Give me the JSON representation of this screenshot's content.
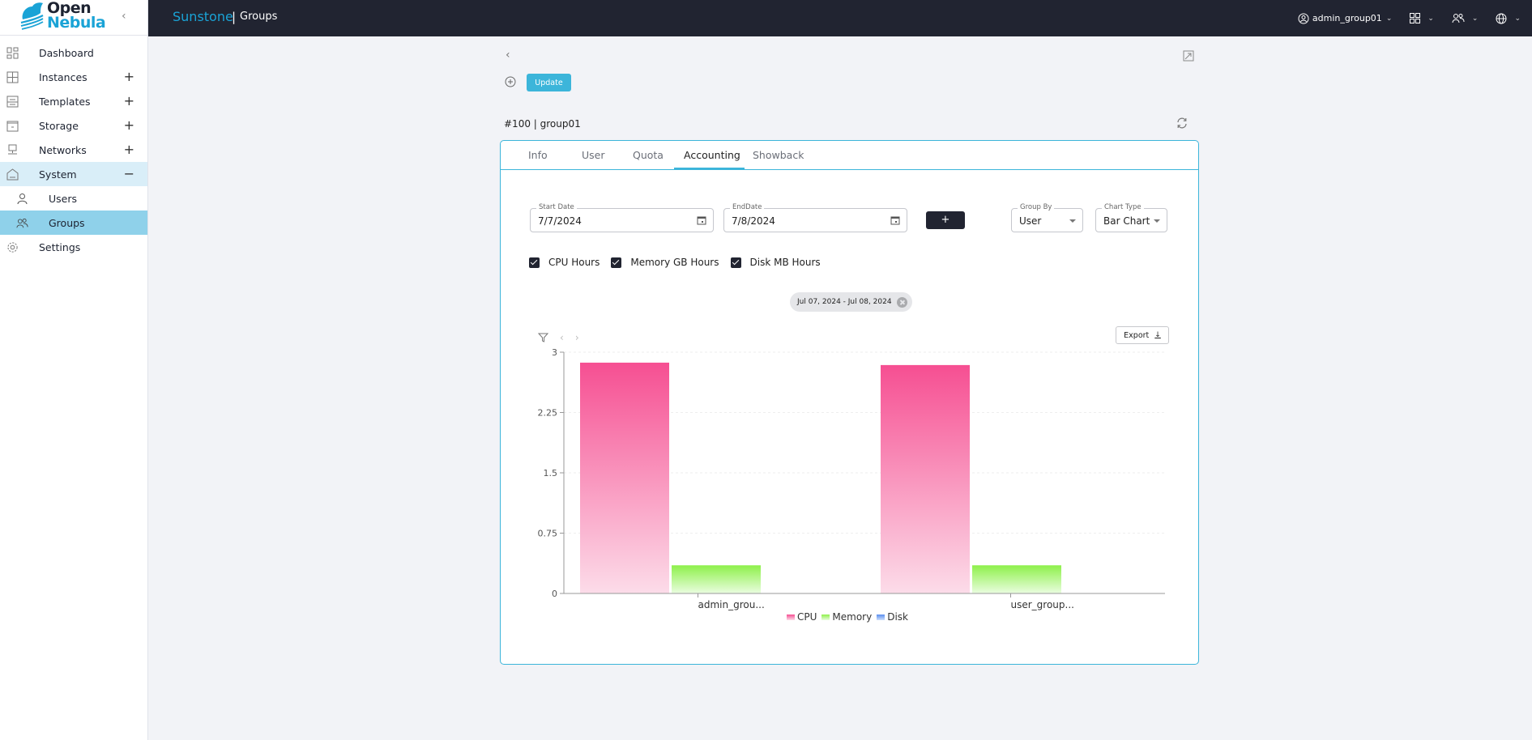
{
  "app": {
    "logo_line1": "Open",
    "logo_line2": "Nebula",
    "brand": "Sunstone",
    "separator": "|",
    "page": "Groups"
  },
  "sidebar": {
    "items": [
      {
        "label": "Dashboard",
        "icon": "dashboard-icon",
        "expandable": false
      },
      {
        "label": "Instances",
        "icon": "instances-icon",
        "expandable": true,
        "toggle": "+"
      },
      {
        "label": "Templates",
        "icon": "templates-icon",
        "expandable": true,
        "toggle": "+"
      },
      {
        "label": "Storage",
        "icon": "storage-icon",
        "expandable": true,
        "toggle": "+"
      },
      {
        "label": "Networks",
        "icon": "networks-icon",
        "expandable": true,
        "toggle": "+"
      },
      {
        "label": "System",
        "icon": "system-icon",
        "expandable": true,
        "toggle": "−",
        "open": true
      },
      {
        "label": "Users",
        "icon": "user-icon",
        "sub": true
      },
      {
        "label": "Groups",
        "icon": "group-icon",
        "sub": true,
        "active": true
      },
      {
        "label": "Settings",
        "icon": "gear-icon",
        "expandable": false
      }
    ]
  },
  "topbar": {
    "user": "admin_group01",
    "view_icon": "grid-icon",
    "group_icon": "users-icon",
    "lang_icon": "globe-icon"
  },
  "toolbar": {
    "update_label": "Update"
  },
  "resource": {
    "title": "#100 | group01"
  },
  "tabs": [
    {
      "label": "Info"
    },
    {
      "label": "User"
    },
    {
      "label": "Quota"
    },
    {
      "label": "Accounting",
      "active": true
    },
    {
      "label": "Showback"
    }
  ],
  "accounting": {
    "start_date_label": "Start Date",
    "start_date": "7/7/2024",
    "end_date_label": "EndDate",
    "end_date": "7/8/2024",
    "add_label": "+",
    "group_by_label": "Group By",
    "group_by": "User",
    "chart_type_label": "Chart Type",
    "chart_type": "Bar Chart",
    "checkboxes": [
      {
        "label": "CPU Hours",
        "checked": true
      },
      {
        "label": "Memory GB Hours",
        "checked": true
      },
      {
        "label": "Disk MB Hours",
        "checked": true
      }
    ],
    "range_chip": "Jul 07, 2024 - Jul 08, 2024",
    "export_label": "Export"
  },
  "chart_data": {
    "type": "bar",
    "categories": [
      "admin_grou...",
      "user_group..."
    ],
    "series": [
      {
        "name": "CPU",
        "values": [
          2.87,
          2.84
        ],
        "color_top": "#f64f92",
        "color_bottom": "#fcdce9"
      },
      {
        "name": "Memory",
        "values": [
          0.35,
          0.35
        ],
        "color_top": "#8ef04a",
        "color_bottom": "#eafde0"
      },
      {
        "name": "Disk",
        "values": [
          0,
          0
        ],
        "color_top": "#5b8ff0",
        "color_bottom": "#cfe0fb"
      }
    ],
    "yticks": [
      "0",
      "0.75",
      "1.5",
      "2.25",
      "3"
    ],
    "ylim": [
      0,
      3
    ],
    "grid": true,
    "legend": "bottom"
  }
}
